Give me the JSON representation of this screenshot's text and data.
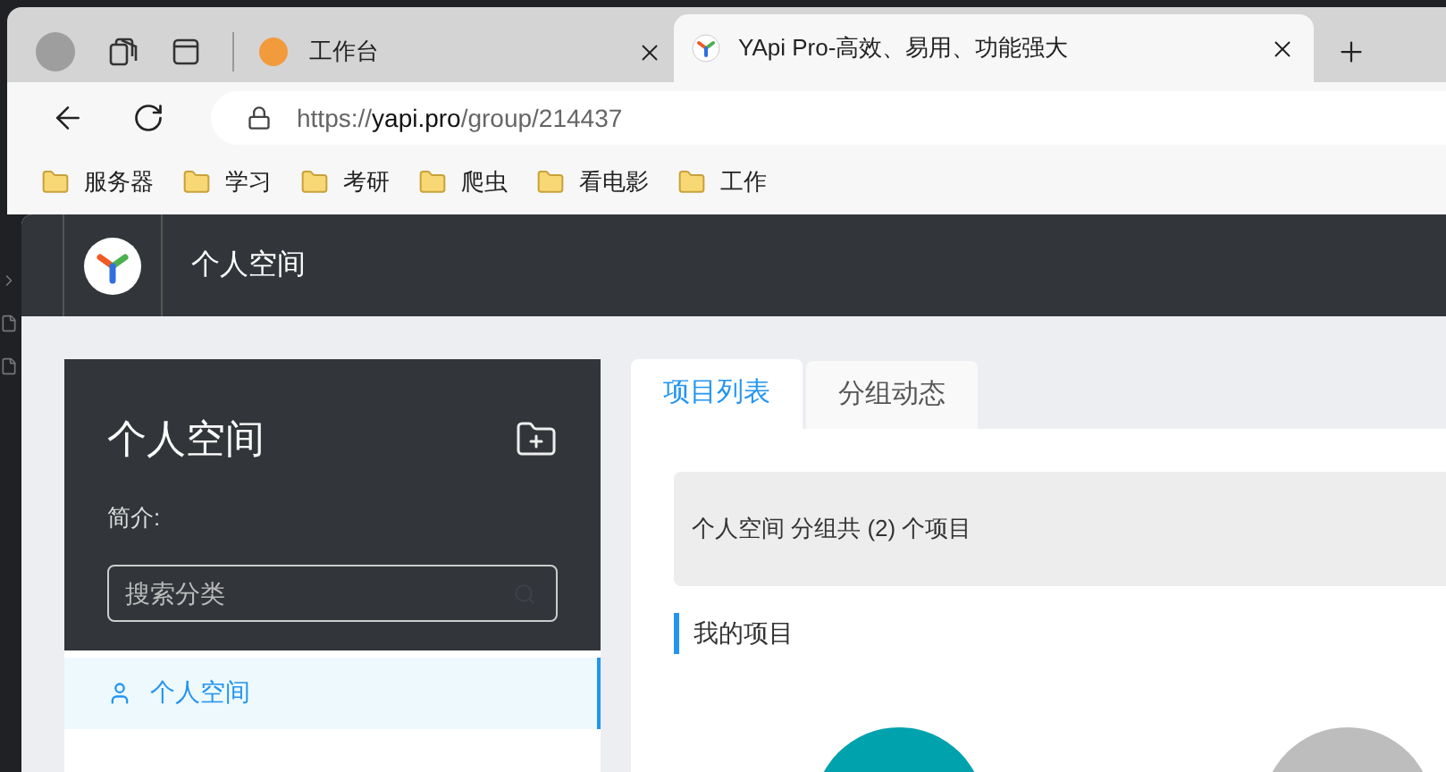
{
  "browser": {
    "tabs": [
      {
        "title": "工作台",
        "selected": false
      },
      {
        "title": "YApi Pro-高效、易用、功能强大",
        "selected": true
      }
    ],
    "url": {
      "scheme": "https://",
      "host": "yapi.pro",
      "path": "/group/214437"
    },
    "bookmarks": [
      "服务器",
      "学习",
      "考研",
      "爬虫",
      "看电影",
      "工作"
    ]
  },
  "header": {
    "title": "个人空间"
  },
  "sidebar": {
    "title": "个人空间",
    "intro_label": "简介:",
    "search": {
      "placeholder": "搜索分类"
    },
    "items": [
      {
        "label": "个人空间",
        "selected": true
      }
    ]
  },
  "tabs": [
    {
      "label": "项目列表",
      "selected": true
    },
    {
      "label": "分组动态",
      "selected": false
    }
  ],
  "summary": "个人空间 分组共 (2) 个项目",
  "section_title": "我的项目",
  "projects": [
    {
      "color": "#00a2ae"
    },
    {
      "color": "#bdbdbd"
    }
  ]
}
